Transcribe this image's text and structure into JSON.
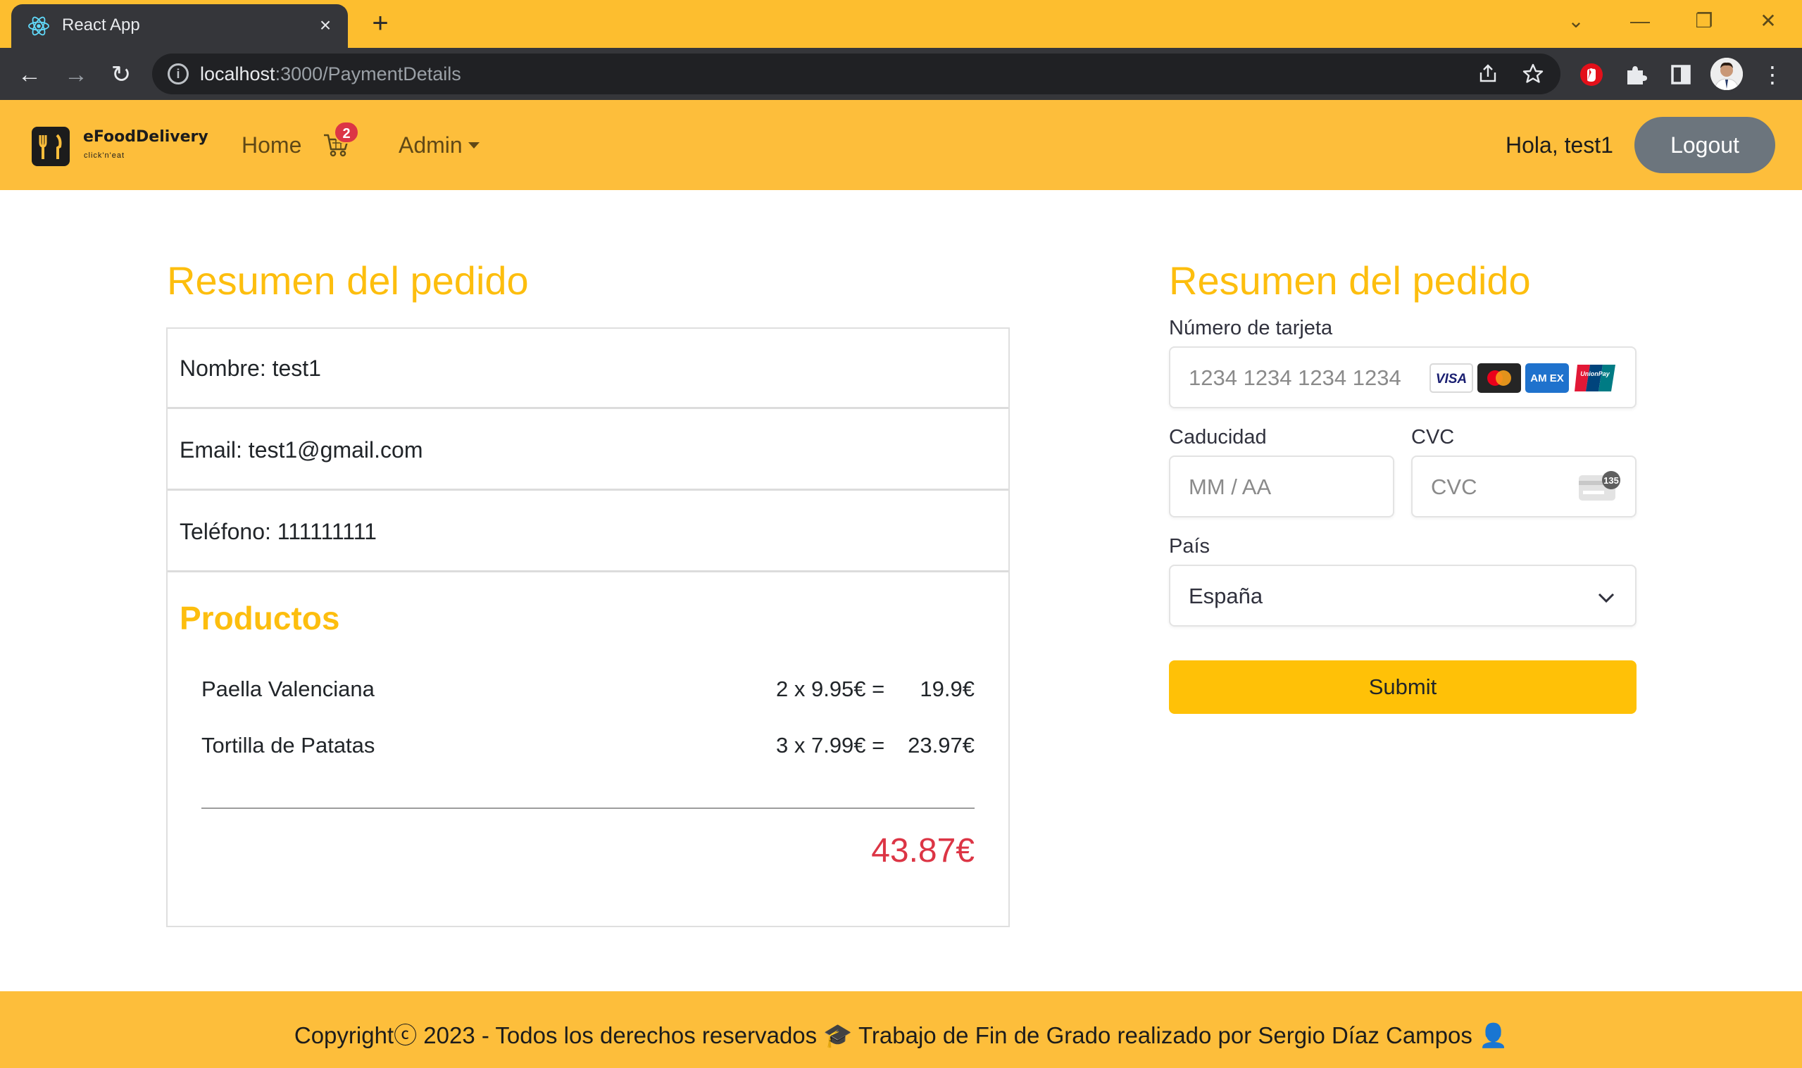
{
  "browser": {
    "tab_title": "React App",
    "tab_close": "×",
    "new_tab": "+",
    "url_host": "localhost",
    "url_path": ":3000/PaymentDetails",
    "controls": {
      "dropdown": "⌄",
      "minimize": "—",
      "restore": "❐",
      "close": "✕"
    },
    "nav": {
      "back": "←",
      "forward": "→",
      "reload": "↻"
    }
  },
  "navbar": {
    "brand": "eFoodDelivery",
    "brand_tagline": "click'n'eat",
    "home_label": "Home",
    "cart_count": "2",
    "admin_label": "Admin",
    "greeting": "Hola, test1",
    "logout_label": "Logout"
  },
  "summary": {
    "title": "Resumen del pedido",
    "name": "Nombre: test1",
    "email": "Email: test1@gmail.com",
    "phone": "Teléfono: 111111111",
    "products_title": "Productos",
    "products": [
      {
        "name": "Paella Valenciana",
        "qty_price": "2 x 9.95€ =",
        "total": "19.9€"
      },
      {
        "name": "Tortilla de Patatas",
        "qty_price": "3 x 7.99€ =",
        "total": "23.97€"
      }
    ],
    "grand_total": "43.87€"
  },
  "payment": {
    "title": "Resumen del pedido",
    "card_number_label": "Número de tarjeta",
    "card_number_placeholder": "1234 1234 1234 1234",
    "card_brands": [
      "visa-icon",
      "mastercard-icon",
      "amex-icon",
      "unionpay-icon"
    ],
    "visa_text": "VISA",
    "amex_text": "AM EX",
    "unionpay_text": "UnionPay",
    "expiry_label": "Caducidad",
    "expiry_placeholder": "MM / AA",
    "cvc_label": "CVC",
    "cvc_placeholder": "CVC",
    "cvc_badge": "135",
    "country_label": "País",
    "country_value": "España",
    "submit_label": "Submit"
  },
  "footer": {
    "text": "Copyrightⓒ 2023 - Todos los derechos reservados 🎓 Trabajo de Fin de Grado realizado por Sergio Díaz Campos 👤"
  },
  "colors": {
    "accent": "#fdbe3b",
    "title": "#fdbe0e",
    "total": "#dc3545",
    "submit": "#ffc107",
    "logout": "#6c757d"
  }
}
